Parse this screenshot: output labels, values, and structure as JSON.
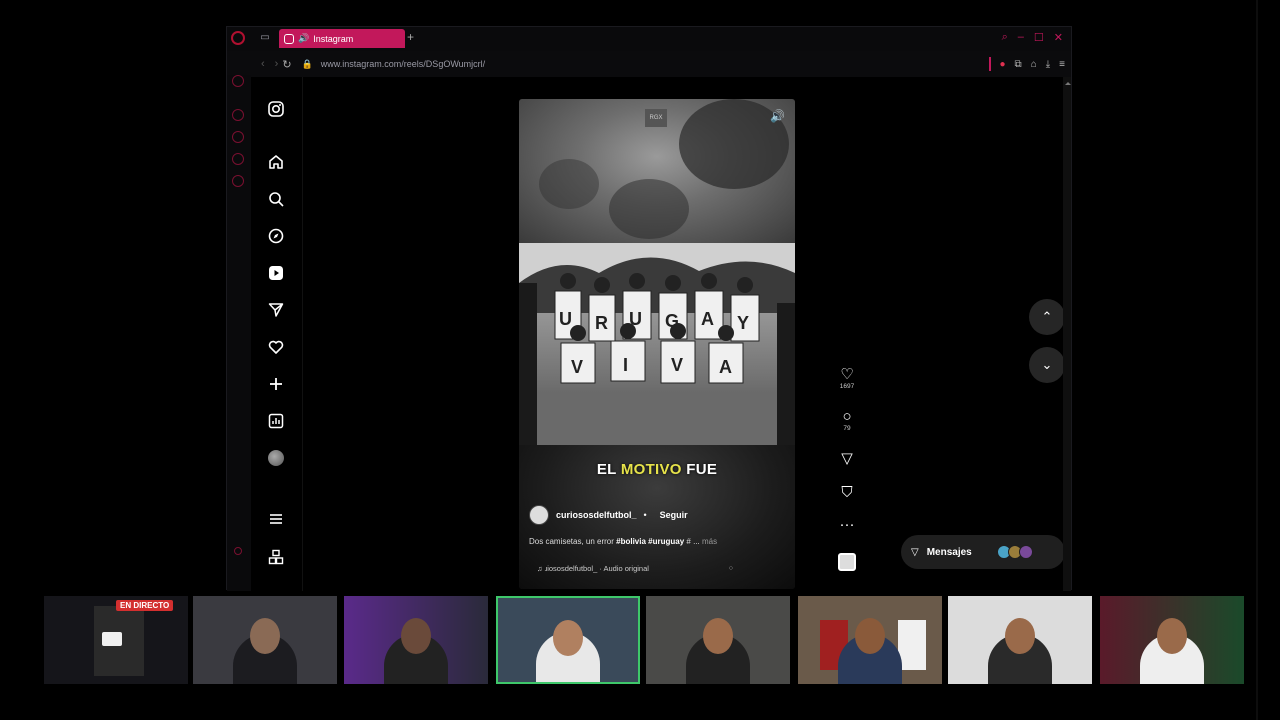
{
  "browser": {
    "tab_title": "Instagram",
    "new_tab_label": "+",
    "url": "www.instagram.com/reels/DSgOWumjcrl/"
  },
  "instagram": {
    "nav_items": [
      "instagram-logo",
      "home-icon",
      "search-icon",
      "explore-icon",
      "reels-icon",
      "messages-icon",
      "notifications-icon",
      "create-icon",
      "dashboard-icon",
      "profile-avatar",
      "more-icon",
      "also-from-meta-icon"
    ],
    "reel": {
      "badge": "RGX",
      "caption_parts": [
        "EL ",
        "MOTIVO",
        " FUE"
      ],
      "author": "curiososdelfutbol_",
      "separator": "•",
      "follow_label": "Seguir",
      "description_prefix": "Dos camisetas, un error ",
      "hashtag_1": "#bolivia",
      "hashtag_2": "#uruguay",
      "description_suffix": " # ...",
      "more_label": "más",
      "audio": "♫ ɹiososdelfutbol_ · Audio original"
    },
    "actions": {
      "likes": "1697",
      "comments": "79"
    },
    "messages_label": "Mensajes"
  },
  "stream": {
    "live_badge": "EN DIRECTO"
  },
  "colors": {
    "accent": "#c2185b",
    "highlight": "#e6e24a",
    "active_tile": "#3ec76a"
  }
}
